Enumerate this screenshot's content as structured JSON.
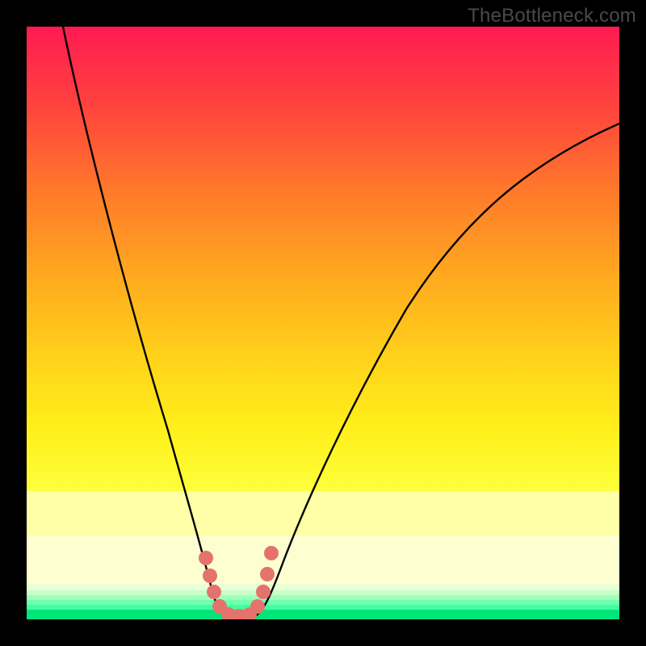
{
  "watermark": "TheBottleneck.com",
  "chart_data": {
    "type": "line",
    "title": "",
    "xlabel": "",
    "ylabel": "",
    "xlim": [
      0,
      100
    ],
    "ylim": [
      0,
      100
    ],
    "series": [
      {
        "name": "bottleneck-curve",
        "x": [
          6,
          10,
          14,
          18,
          22,
          26,
          28,
          30,
          31,
          32,
          33,
          34,
          35,
          36,
          37,
          38,
          40,
          45,
          50,
          55,
          60,
          65,
          70,
          75,
          80,
          85,
          90,
          95,
          100
        ],
        "y": [
          100,
          90,
          78,
          65,
          50,
          32,
          22,
          12,
          7,
          3,
          1,
          0,
          0,
          0,
          0.5,
          1.5,
          4,
          13,
          23,
          32,
          40,
          47,
          54,
          60,
          65,
          70,
          74,
          78,
          81
        ]
      }
    ],
    "markers": {
      "name": "highlight-points",
      "color": "#e5736d",
      "x": [
        30,
        30.8,
        31.5,
        32.5,
        34,
        35.5,
        37,
        37.8,
        38.3,
        38.7
      ],
      "y": [
        10,
        6,
        3,
        1,
        0,
        0,
        1,
        3,
        6,
        10
      ]
    },
    "gradient_bands": [
      {
        "y": 100,
        "color": "#ff1a52"
      },
      {
        "y": 85,
        "color": "#ff4b3c"
      },
      {
        "y": 70,
        "color": "#ff7a2a"
      },
      {
        "y": 55,
        "color": "#ffa91f"
      },
      {
        "y": 40,
        "color": "#ffd21a"
      },
      {
        "y": 28,
        "color": "#fff01a"
      },
      {
        "y": 18,
        "color": "#fdff3a"
      },
      {
        "y": 12,
        "color": "#f2ff70"
      },
      {
        "y": 8,
        "color": "#d8ffa0"
      },
      {
        "y": 5,
        "color": "#a8ffb0"
      },
      {
        "y": 2,
        "color": "#5affc0"
      },
      {
        "y": 0,
        "color": "#00ff7a"
      }
    ]
  }
}
